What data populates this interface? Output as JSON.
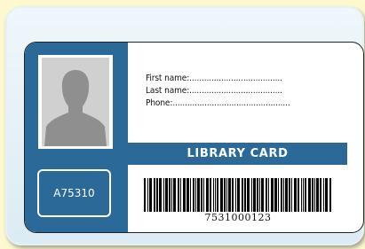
{
  "card": {
    "id_number": "A75310",
    "title": "LIBRARY CARD",
    "fields": [
      {
        "label": "First name:",
        "dots": "......................................"
      },
      {
        "label": "Last name:",
        "dots": "......................................"
      },
      {
        "label": "Phone:",
        "dots": "................................................"
      }
    ],
    "barcode_number": "7531000123"
  },
  "colors": {
    "background": "#fdf8d0",
    "card_blue": "#2b6a98",
    "card_outer": "#eef7fb"
  },
  "icons": {
    "photo": "person-silhouette-icon",
    "barcode": "barcode-icon"
  }
}
